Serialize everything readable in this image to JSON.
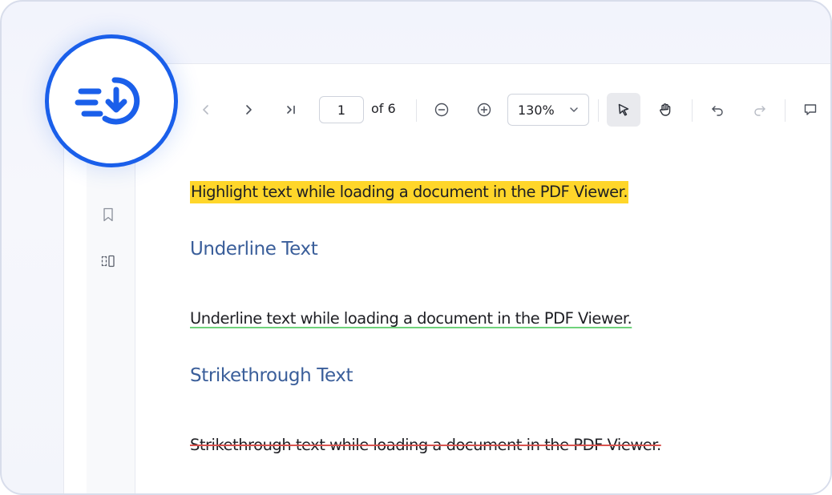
{
  "toolbar": {
    "current_page": "1",
    "page_total": "of 6",
    "zoom": "130%",
    "icons": [
      "chevron-left-icon",
      "chevron-right-icon",
      "last-page-icon",
      "zoom-out-icon",
      "zoom-in-icon",
      "chevron-down-icon",
      "select-pointer-icon",
      "pan-hand-icon",
      "undo-icon",
      "redo-icon",
      "comment-icon"
    ]
  },
  "sidebar": {
    "icons": [
      "bookmark-icon",
      "organize-pages-icon"
    ]
  },
  "document": {
    "highlight_text": "Highlight text while loading a document in the PDF Viewer.",
    "underline_heading": "Underline Text",
    "underline_text": "Underline text while loading a document in the PDF Viewer.",
    "strike_heading": "Strikethrough Text",
    "strike_text": "Strikethrough text while loading a document in the PDF Viewer."
  },
  "colors": {
    "accent": "#1a5fea",
    "highlight": "#ffd62a",
    "underline": "#6fd27b",
    "strikethrough": "#d9534f",
    "heading": "#3a5e9a"
  }
}
